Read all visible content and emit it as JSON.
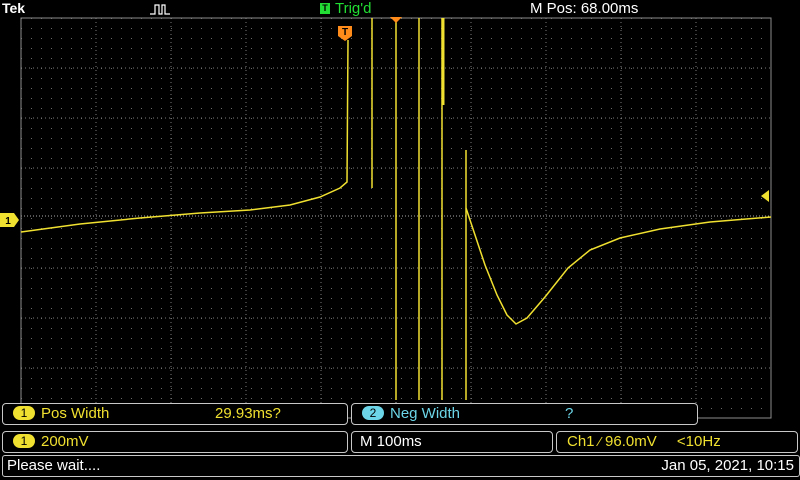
{
  "header": {
    "brand": "Tek",
    "trigger_indicator": "T",
    "trigger_status": "Trig'd",
    "m_pos": "M Pos: 68.00ms"
  },
  "markers": {
    "trigger_marker": "T",
    "ch1_marker": "1"
  },
  "measurements": [
    {
      "channel": "1",
      "label": "Pos Width",
      "value": "29.93ms?"
    },
    {
      "channel": "2",
      "label": "Neg Width",
      "value": "?"
    }
  ],
  "settings": {
    "ch1_channel": "1",
    "ch1_scale": "200mV",
    "timebase": "M 100ms",
    "trigger_source": "Ch1",
    "trigger_slope": "⁄",
    "trigger_level": "96.0mV",
    "trigger_freq": "<10Hz"
  },
  "status": {
    "message": "Please wait....",
    "datetime": "Jan 05, 2021, 10:15"
  },
  "colors": {
    "ch1": "#f0e030",
    "ch2": "#6cd6e8",
    "trigger": "#ff8c1a",
    "status_ok": "#22dd33"
  }
}
